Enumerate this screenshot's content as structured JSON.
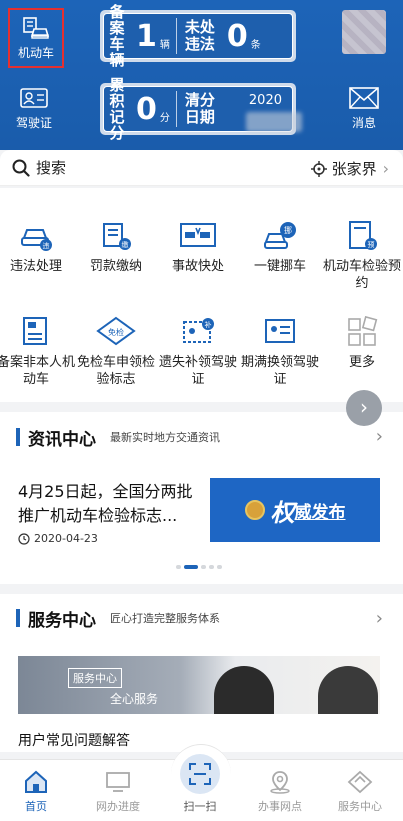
{
  "header": {
    "vehicle_label": "机动车",
    "license_label": "驾驶证",
    "message_label": "消息",
    "plate1": {
      "label_a": "备案车辆",
      "count_a": "1",
      "unit_a": "辆",
      "label_b": "未处违法",
      "count_b": "0",
      "unit_b": "条"
    },
    "plate2": {
      "label_a": "累积记分",
      "count_a": "0",
      "unit_a": "分",
      "label_b": "清分日期",
      "year": "2020"
    }
  },
  "search": {
    "label": "搜索",
    "location": "张家界"
  },
  "grid": [
    {
      "label": "违法处理",
      "icon": "car-violation-icon"
    },
    {
      "label": "罚款缴纳",
      "icon": "fine-payment-icon"
    },
    {
      "label": "事故快处",
      "icon": "accident-icon"
    },
    {
      "label": "一键挪车",
      "icon": "move-car-icon"
    },
    {
      "label": "机动车检验预约",
      "icon": "inspection-appointment-icon"
    },
    {
      "label": "备案非本人机动车",
      "icon": "register-vehicle-icon"
    },
    {
      "label": "免检车申领检验标志",
      "icon": "exempt-label-icon"
    },
    {
      "label": "遗失补领驾驶证",
      "icon": "reissue-license-icon"
    },
    {
      "label": "期满换领驾驶证",
      "icon": "renew-license-icon"
    },
    {
      "label": "更多",
      "icon": "more-icon"
    }
  ],
  "news_section": {
    "title": "资讯中心",
    "subtitle": "最新实时地方交通资讯"
  },
  "news": {
    "title": "4月25日起，全国分两批推广机动车检验标志...",
    "date": "2020-04-23",
    "banner_a": "权",
    "banner_b": "威发布"
  },
  "service_section": {
    "title": "服务中心",
    "subtitle": "匠心打造完整服务体系",
    "tag": "服务中心",
    "tagline": "全心服务",
    "caption": "用户常见问题解答"
  },
  "tabs": [
    {
      "label": "首页",
      "icon": "home-icon"
    },
    {
      "label": "网办进度",
      "icon": "monitor-icon"
    },
    {
      "label": "扫一扫",
      "icon": "scan-icon"
    },
    {
      "label": "办事网点",
      "icon": "location-pin-icon"
    },
    {
      "label": "服务中心",
      "icon": "service-icon"
    }
  ],
  "colors": {
    "primary": "#1d64b8",
    "highlight_border": "#e53030"
  }
}
